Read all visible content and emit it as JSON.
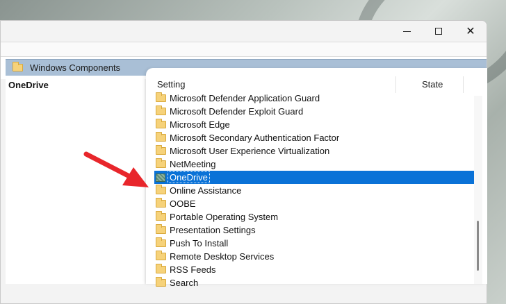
{
  "window": {
    "controls": {
      "minimize": "minimize-icon",
      "maximize": "maximize-icon",
      "close": "close-icon",
      "close_glyph": "✕"
    }
  },
  "path_bar": {
    "label": "Windows Components",
    "icon": "folder-icon"
  },
  "left_pane": {
    "title": "OneDrive"
  },
  "columns": {
    "setting": "Setting",
    "state": "State"
  },
  "rows": [
    {
      "label": "Microsoft Defender Application Guard",
      "icon": "folder-icon"
    },
    {
      "label": "Microsoft Defender Exploit Guard",
      "icon": "folder-icon"
    },
    {
      "label": "Microsoft Edge",
      "icon": "folder-icon"
    },
    {
      "label": "Microsoft Secondary Authentication Factor",
      "icon": "folder-icon"
    },
    {
      "label": "Microsoft User Experience Virtualization",
      "icon": "folder-icon"
    },
    {
      "label": "NetMeeting",
      "icon": "folder-icon"
    },
    {
      "label": "OneDrive",
      "icon": "policy-icon",
      "selected": true
    },
    {
      "label": "Online Assistance",
      "icon": "folder-icon"
    },
    {
      "label": "OOBE",
      "icon": "folder-icon"
    },
    {
      "label": "Portable Operating System",
      "icon": "folder-icon"
    },
    {
      "label": "Presentation Settings",
      "icon": "folder-icon"
    },
    {
      "label": "Push To Install",
      "icon": "folder-icon"
    },
    {
      "label": "Remote Desktop Services",
      "icon": "folder-icon"
    },
    {
      "label": "RSS Feeds",
      "icon": "folder-icon"
    },
    {
      "label": "Search",
      "icon": "folder-icon"
    }
  ],
  "colors": {
    "selection": "#0a72d7",
    "path_bar": "#a9bfd6",
    "annotation_arrow": "#e8262b"
  }
}
